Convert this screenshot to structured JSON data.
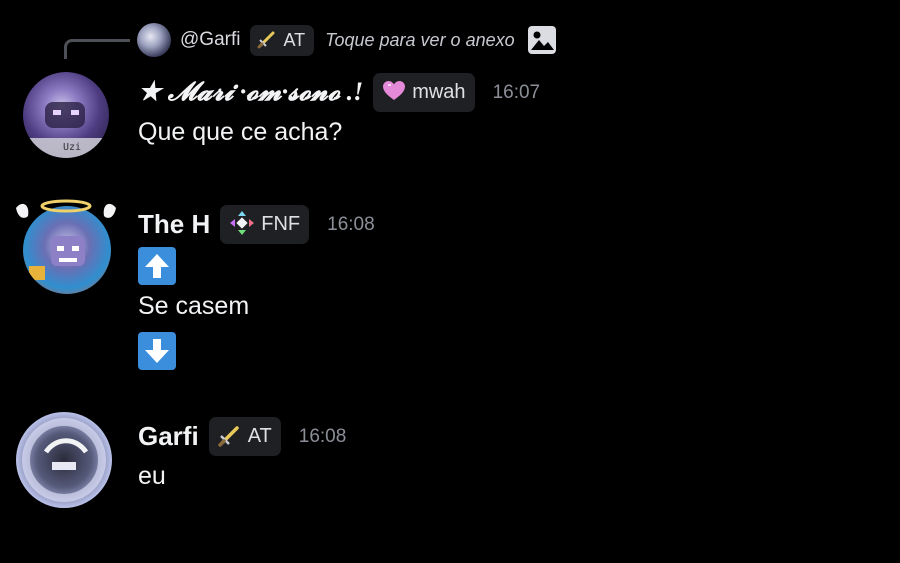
{
  "reply": {
    "username": "@Garfi",
    "tag_label": "AT",
    "tag_icon": "sword-icon",
    "preview_text": "Toque para ver o anexo",
    "attachment_icon": "image-icon"
  },
  "messages": [
    {
      "username": "★ 𝓜𝓪𝓻𝓲 ·𝓸𝓶·𝓼𝓸𝓷𝓸 .!",
      "tag_label": "mwah",
      "tag_icon": "pink-heart-icon",
      "time": "16:07",
      "avatar_label": "Uzi",
      "lines": [
        "Que que ce acha?"
      ]
    },
    {
      "username": "The H",
      "tag_label": "FNF",
      "tag_icon": "diamond-arrows-icon",
      "time": "16:08",
      "lines": [
        "Se casem"
      ],
      "emoji": [
        "arrow-up-icon",
        "arrow-down-icon"
      ]
    },
    {
      "username": "Garfi",
      "tag_label": "AT",
      "tag_icon": "sword-icon",
      "time": "16:08",
      "lines": [
        "eu"
      ]
    }
  ],
  "colors": {
    "background": "#000000",
    "text": "#f2f3f5",
    "timestamp": "#8c8f98",
    "tag_background": "#1f2023",
    "emoji_blue": "#3b8edb"
  }
}
